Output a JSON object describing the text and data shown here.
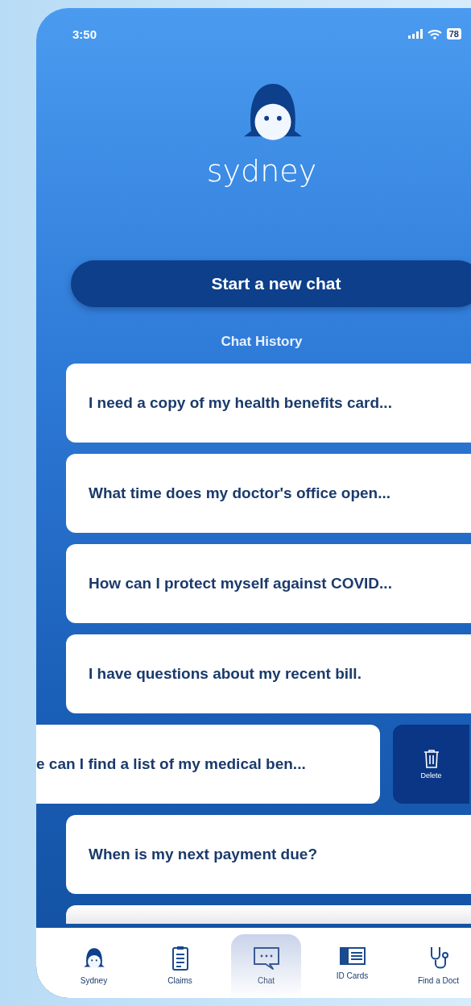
{
  "status_bar": {
    "time": "3:50",
    "battery": "78"
  },
  "brand": {
    "name": "sydney"
  },
  "new_chat_button": "Start a new chat",
  "history_title": "Chat History",
  "chats": [
    {
      "kind": "card",
      "text": "I need a copy of my health benefits card..."
    },
    {
      "kind": "card",
      "text": "What time does my doctor's office open..."
    },
    {
      "kind": "card",
      "text": "How can I protect myself against COVID..."
    },
    {
      "kind": "card",
      "text": "I have questions about my recent bill."
    },
    {
      "kind": "swiped",
      "text": "e can I find a list of my medical ben...",
      "action": "Delete"
    },
    {
      "kind": "card",
      "text": "When is my next payment due?"
    },
    {
      "kind": "partial"
    }
  ],
  "tabs": [
    {
      "label": "Sydney",
      "kind": "avatar",
      "selected": false
    },
    {
      "label": "Claims",
      "kind": "clipboard",
      "selected": false
    },
    {
      "label": "Chat",
      "kind": "chat",
      "selected": true
    },
    {
      "label": "ID Cards",
      "kind": "card",
      "selected": false
    },
    {
      "label": "Find a Doct",
      "kind": "stethoscope",
      "selected": false
    }
  ]
}
